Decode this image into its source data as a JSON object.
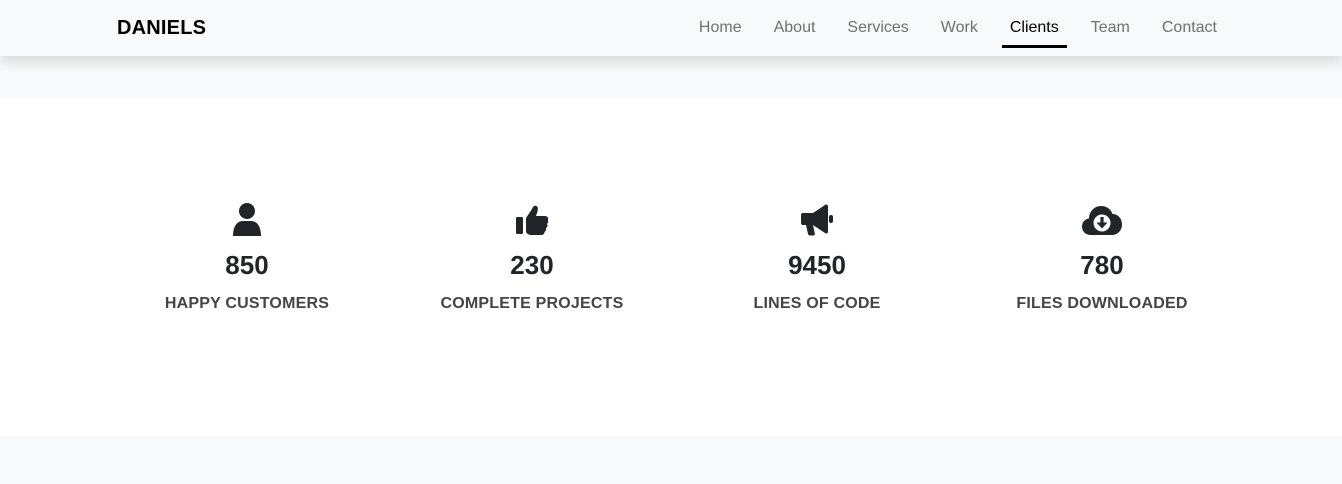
{
  "navbar": {
    "brand": "DANIELS",
    "links": [
      {
        "label": "Home",
        "active": false
      },
      {
        "label": "About",
        "active": false
      },
      {
        "label": "Services",
        "active": false
      },
      {
        "label": "Work",
        "active": false
      },
      {
        "label": "Clients",
        "active": true
      },
      {
        "label": "Team",
        "active": false
      },
      {
        "label": "Contact",
        "active": false
      }
    ]
  },
  "stats": [
    {
      "icon": "user-icon",
      "value": "850",
      "label": "HAPPY CUSTOMERS"
    },
    {
      "icon": "thumbs-up-icon",
      "value": "230",
      "label": "COMPLETE PROJECTS"
    },
    {
      "icon": "bullhorn-icon",
      "value": "9450",
      "label": "LINES OF CODE"
    },
    {
      "icon": "cloud-download-icon",
      "value": "780",
      "label": "FILES DOWNLOADED"
    }
  ],
  "colors": {
    "navbar_background": "#f8f9fa",
    "page_background": "#f8f9fa",
    "stats_background": "#ffffff",
    "active_link": "#000000",
    "inactive_link": "#707070",
    "icon_color": "#212529"
  }
}
